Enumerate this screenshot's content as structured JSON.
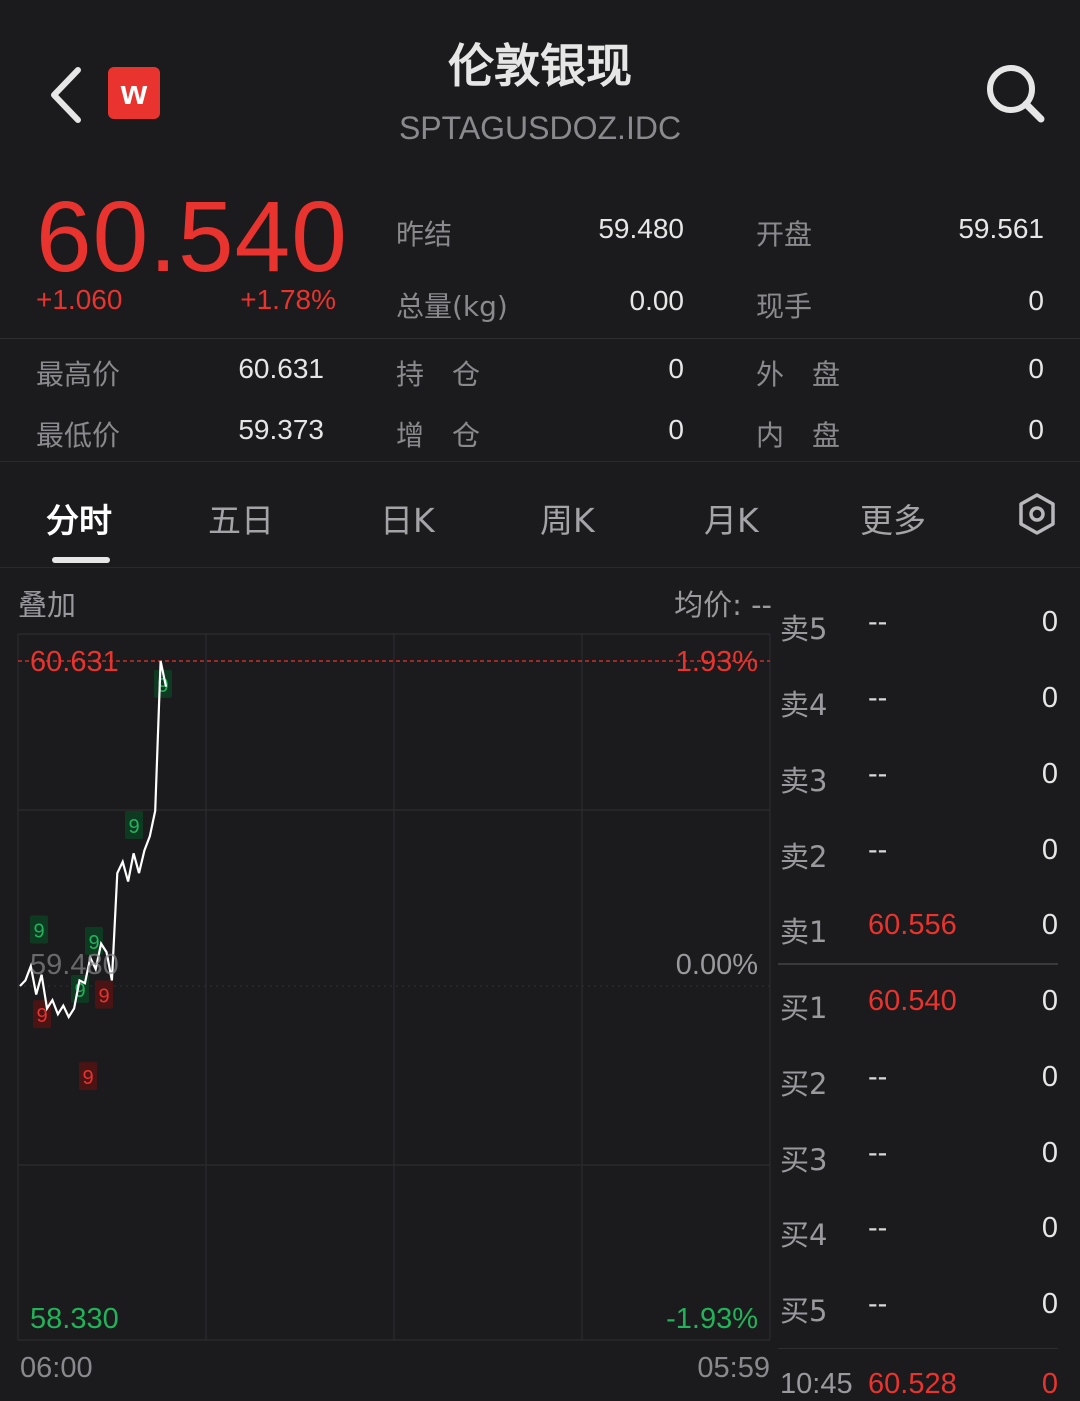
{
  "header": {
    "title": "伦敦银现",
    "subtitle": "SPTAGUSDOZ.IDC",
    "brand_badge": "w"
  },
  "quote": {
    "last_price": "60.540",
    "change_abs": "+1.060",
    "change_pct": "+1.78%",
    "stats": [
      {
        "label": "昨结",
        "value": "59.480"
      },
      {
        "label": "开盘",
        "value": "59.561"
      },
      {
        "label": "总量(kg)",
        "value": "0.00"
      },
      {
        "label": "现手",
        "value": "0"
      },
      {
        "label": "最高价",
        "value": "60.631"
      },
      {
        "label": "持　仓",
        "value": "0"
      },
      {
        "label": "外　盘",
        "value": "0"
      },
      {
        "label": "最低价",
        "value": "59.373"
      },
      {
        "label": "增　仓",
        "value": "0"
      },
      {
        "label": "内　盘",
        "value": "0"
      }
    ]
  },
  "tabs": [
    "分时",
    "五日",
    "日K",
    "周K",
    "月K",
    "更多"
  ],
  "active_tab": "分时",
  "chart": {
    "overlay_label": "叠加",
    "avg_price_label": "均价: --",
    "y_max": "60.631",
    "y_min": "58.330",
    "y_ref": "59.480",
    "pct_max": "1.93%",
    "pct_mid": "0.00%",
    "pct_min": "-1.93%",
    "time_start": "06:00",
    "time_end": "05:59",
    "marker_label": "9",
    "colors": {
      "up": "#e8332e",
      "down": "#22b35a",
      "line": "#ffffff"
    }
  },
  "chart_data": {
    "type": "line",
    "x_range": [
      "06:00",
      "05:59"
    ],
    "ylim": [
      58.33,
      60.631
    ],
    "series": [
      {
        "values": [
          59.48,
          59.5,
          59.55,
          59.45,
          59.52,
          59.4,
          59.43,
          59.38,
          59.41,
          59.37,
          59.4,
          59.5,
          59.49,
          59.58,
          59.54,
          59.63,
          59.6,
          59.5,
          59.88,
          59.92,
          59.85,
          59.95,
          59.88,
          59.96,
          60.01,
          60.1,
          60.631,
          60.54
        ]
      }
    ]
  },
  "order_book": {
    "asks": [
      {
        "label": "卖5",
        "price": "--",
        "volume": "0"
      },
      {
        "label": "卖4",
        "price": "--",
        "volume": "0"
      },
      {
        "label": "卖3",
        "price": "--",
        "volume": "0"
      },
      {
        "label": "卖2",
        "price": "--",
        "volume": "0"
      },
      {
        "label": "卖1",
        "price": "60.556",
        "volume": "0"
      }
    ],
    "bids": [
      {
        "label": "买1",
        "price": "60.540",
        "volume": "0"
      },
      {
        "label": "买2",
        "price": "--",
        "volume": "0"
      },
      {
        "label": "买3",
        "price": "--",
        "volume": "0"
      },
      {
        "label": "买4",
        "price": "--",
        "volume": "0"
      },
      {
        "label": "买5",
        "price": "--",
        "volume": "0"
      }
    ],
    "last_trade": {
      "time": "10:45",
      "price": "60.528",
      "volume": "0"
    }
  }
}
